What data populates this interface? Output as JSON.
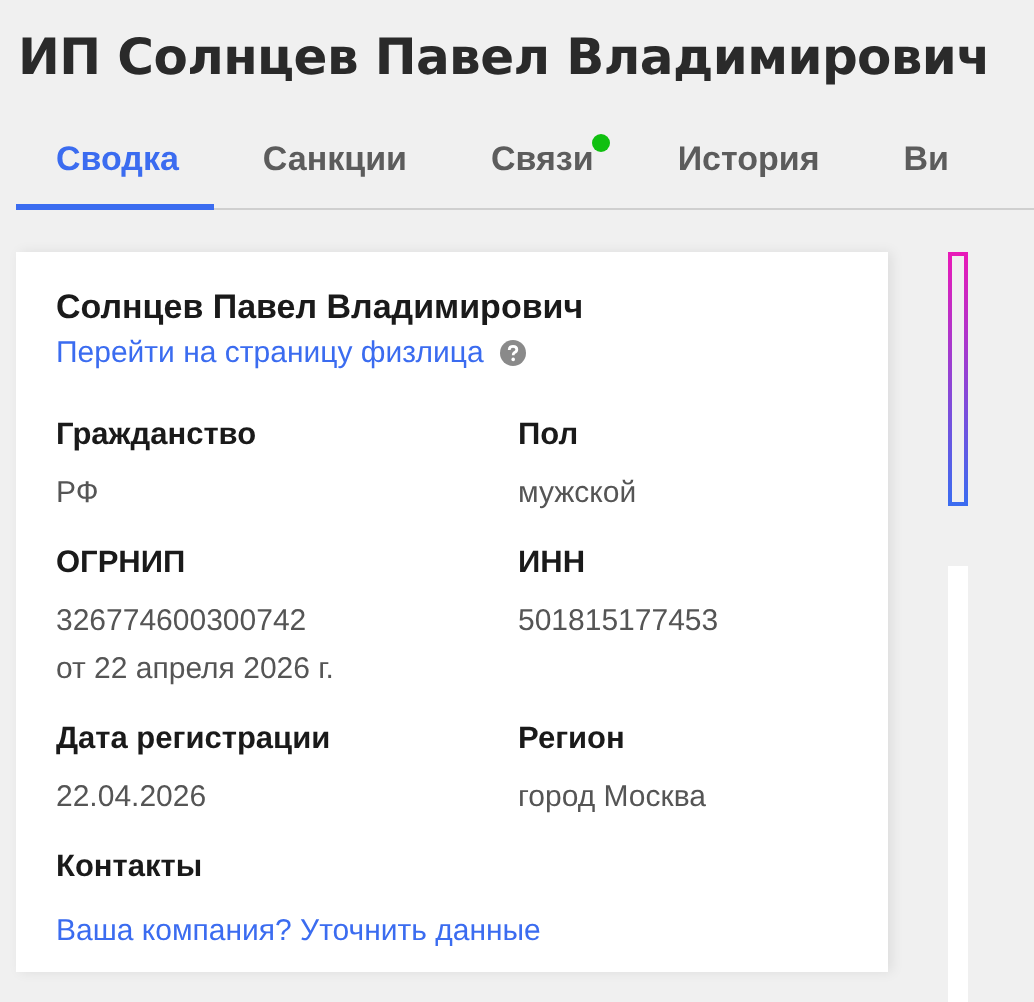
{
  "title": "ИП Солнцев Павел Владимирович",
  "tabs": [
    {
      "label": "Сводка",
      "selected": true,
      "badge": false
    },
    {
      "label": "Санкции",
      "selected": false,
      "badge": false
    },
    {
      "label": "Связи",
      "selected": false,
      "badge": true
    },
    {
      "label": "История",
      "selected": false,
      "badge": false
    },
    {
      "label": "Ви",
      "selected": false,
      "badge": false
    }
  ],
  "card": {
    "name": "Солнцев Павел Владимирович",
    "link": "Перейти на страницу физлица",
    "fields": [
      {
        "label": "Гражданство",
        "values": [
          "РФ"
        ]
      },
      {
        "label": "Пол",
        "values": [
          "мужской"
        ]
      },
      {
        "label": "ОГРНИП",
        "values": [
          "326774600300742",
          "от 22 апреля 2026 г."
        ]
      },
      {
        "label": "ИНН",
        "values": [
          "501815177453"
        ]
      },
      {
        "label": "Дата регистрации",
        "values": [
          "22.04.2026"
        ]
      },
      {
        "label": "Регион",
        "values": [
          "город Москва"
        ]
      }
    ],
    "contacts": {
      "label": "Контакты",
      "link": "Ваша компания? Уточнить данные"
    }
  }
}
